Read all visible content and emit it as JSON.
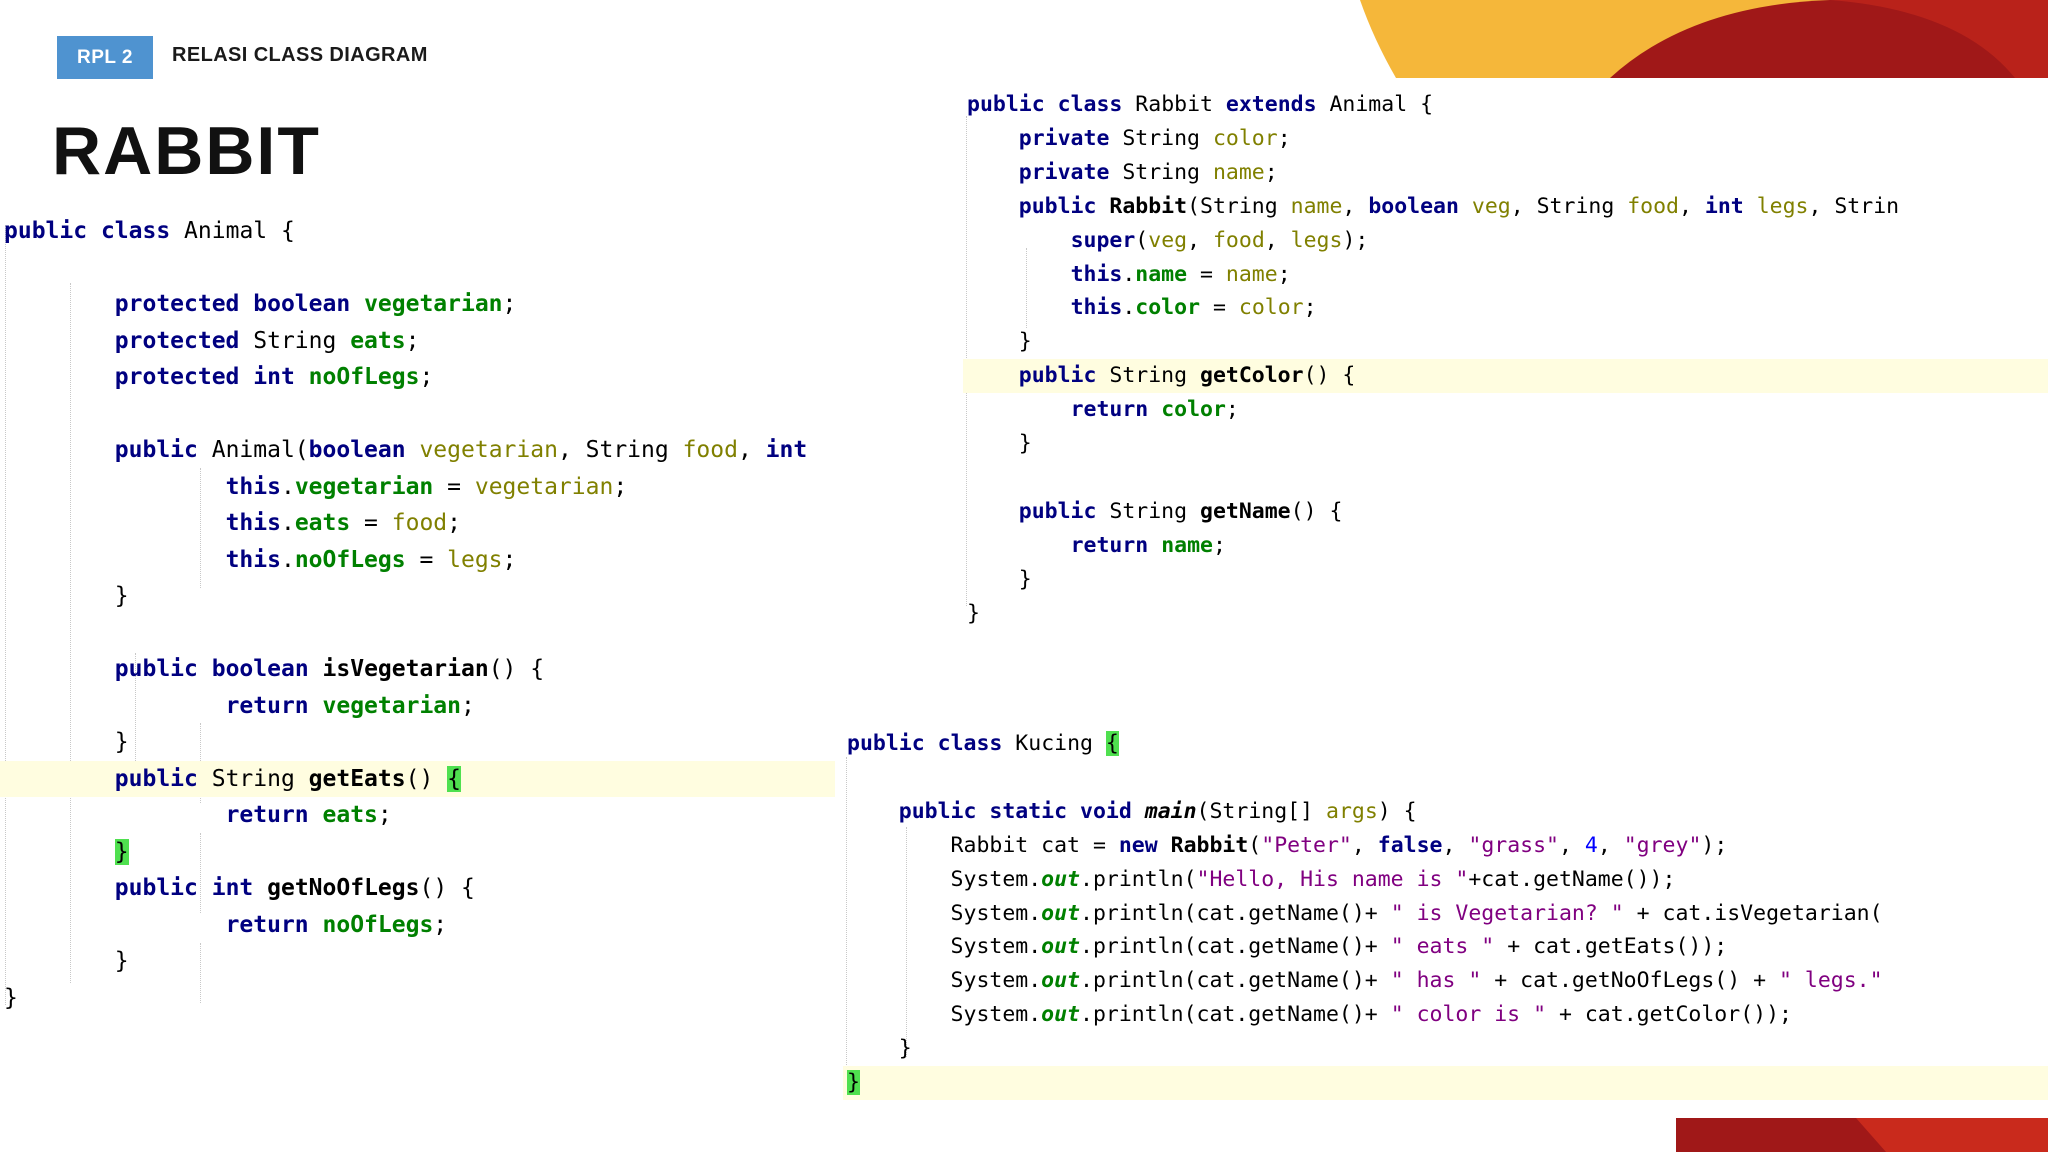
{
  "header": {
    "badge": "RPL 2",
    "subtitle": "RELASI CLASS DIAGRAM"
  },
  "slide": {
    "title": "RABBIT"
  },
  "colors": {
    "keyword": "#000080",
    "field": "#008000",
    "param": "#808000",
    "string": "#800080",
    "number": "#0000ff",
    "bracket_match": "#4fe04f",
    "line_highlight": "#fffde0",
    "badge": "#4f93d0",
    "accent_red": "#a01818",
    "accent_yellow": "#f5b73a"
  },
  "code": {
    "animal": [
      [
        {
          "t": "public",
          "c": "kw"
        },
        {
          "t": " "
        },
        {
          "t": "class",
          "c": "kw"
        },
        {
          "t": " Animal {"
        }
      ],
      [],
      [
        {
          "t": "        "
        },
        {
          "t": "protected",
          "c": "kw"
        },
        {
          "t": " "
        },
        {
          "t": "boolean",
          "c": "kw"
        },
        {
          "t": " "
        },
        {
          "t": "vegetarian",
          "c": "fld"
        },
        {
          "t": ";"
        }
      ],
      [
        {
          "t": "        "
        },
        {
          "t": "protected",
          "c": "kw"
        },
        {
          "t": " String "
        },
        {
          "t": "eats",
          "c": "fld"
        },
        {
          "t": ";"
        }
      ],
      [
        {
          "t": "        "
        },
        {
          "t": "protected",
          "c": "kw"
        },
        {
          "t": " "
        },
        {
          "t": "int",
          "c": "kw"
        },
        {
          "t": " "
        },
        {
          "t": "noOfLegs",
          "c": "fld"
        },
        {
          "t": ";"
        }
      ],
      [],
      [
        {
          "t": "        "
        },
        {
          "t": "public",
          "c": "kw"
        },
        {
          "t": " Animal("
        },
        {
          "t": "boolean",
          "c": "kw"
        },
        {
          "t": " "
        },
        {
          "t": "vegetarian",
          "c": "prm"
        },
        {
          "t": ", String "
        },
        {
          "t": "food",
          "c": "prm"
        },
        {
          "t": ", "
        },
        {
          "t": "int",
          "c": "kw"
        }
      ],
      [
        {
          "t": "                "
        },
        {
          "t": "this",
          "c": "kw"
        },
        {
          "t": "."
        },
        {
          "t": "vegetarian",
          "c": "fld"
        },
        {
          "t": " = "
        },
        {
          "t": "vegetarian",
          "c": "prm"
        },
        {
          "t": ";"
        }
      ],
      [
        {
          "t": "                "
        },
        {
          "t": "this",
          "c": "kw"
        },
        {
          "t": "."
        },
        {
          "t": "eats",
          "c": "fld"
        },
        {
          "t": " = "
        },
        {
          "t": "food",
          "c": "prm"
        },
        {
          "t": ";"
        }
      ],
      [
        {
          "t": "                "
        },
        {
          "t": "this",
          "c": "kw"
        },
        {
          "t": "."
        },
        {
          "t": "noOfLegs",
          "c": "fld"
        },
        {
          "t": " = "
        },
        {
          "t": "legs",
          "c": "prm"
        },
        {
          "t": ";"
        }
      ],
      [
        {
          "t": "        }"
        }
      ],
      [],
      [
        {
          "t": "        "
        },
        {
          "t": "public",
          "c": "kw"
        },
        {
          "t": " "
        },
        {
          "t": "boolean",
          "c": "kw"
        },
        {
          "t": " "
        },
        {
          "t": "isVegetarian",
          "c": "mt"
        },
        {
          "t": "() {"
        }
      ],
      [
        {
          "t": "                "
        },
        {
          "t": "return",
          "c": "kw"
        },
        {
          "t": " "
        },
        {
          "t": "vegetarian",
          "c": "fld"
        },
        {
          "t": ";"
        }
      ],
      [
        {
          "t": "        }"
        }
      ],
      [
        {
          "t": "        "
        },
        {
          "t": "public",
          "c": "kw"
        },
        {
          "t": " String "
        },
        {
          "t": "getEats",
          "c": "mt"
        },
        {
          "t": "() "
        },
        {
          "t": "{",
          "c": "brm"
        }
      ],
      [
        {
          "t": "                "
        },
        {
          "t": "return",
          "c": "kw"
        },
        {
          "t": " "
        },
        {
          "t": "eats",
          "c": "fld"
        },
        {
          "t": ";"
        }
      ],
      [
        {
          "t": "        "
        },
        {
          "t": "}",
          "c": "brm"
        }
      ],
      [
        {
          "t": "        "
        },
        {
          "t": "public",
          "c": "kw"
        },
        {
          "t": " "
        },
        {
          "t": "int",
          "c": "kw"
        },
        {
          "t": " "
        },
        {
          "t": "getNoOfLegs",
          "c": "mt"
        },
        {
          "t": "() {"
        }
      ],
      [
        {
          "t": "                "
        },
        {
          "t": "return",
          "c": "kw"
        },
        {
          "t": " "
        },
        {
          "t": "noOfLegs",
          "c": "fld"
        },
        {
          "t": ";"
        }
      ],
      [
        {
          "t": "        }"
        }
      ],
      [
        {
          "t": "}"
        }
      ]
    ],
    "rabbit": [
      [
        {
          "t": "public",
          "c": "kw"
        },
        {
          "t": " "
        },
        {
          "t": "class",
          "c": "kw"
        },
        {
          "t": " Rabbit "
        },
        {
          "t": "extends",
          "c": "kw"
        },
        {
          "t": " Animal {"
        }
      ],
      [
        {
          "t": "    "
        },
        {
          "t": "private",
          "c": "kw"
        },
        {
          "t": " String "
        },
        {
          "t": "color",
          "c": "prm"
        },
        {
          "t": ";"
        }
      ],
      [
        {
          "t": "    "
        },
        {
          "t": "private",
          "c": "kw"
        },
        {
          "t": " String "
        },
        {
          "t": "name",
          "c": "prm"
        },
        {
          "t": ";"
        }
      ],
      [
        {
          "t": "    "
        },
        {
          "t": "public",
          "c": "kw"
        },
        {
          "t": " "
        },
        {
          "t": "Rabbit",
          "c": "mt"
        },
        {
          "t": "(String "
        },
        {
          "t": "name",
          "c": "prm"
        },
        {
          "t": ", "
        },
        {
          "t": "boolean",
          "c": "kw"
        },
        {
          "t": " "
        },
        {
          "t": "veg",
          "c": "prm"
        },
        {
          "t": ", String "
        },
        {
          "t": "food",
          "c": "prm"
        },
        {
          "t": ", "
        },
        {
          "t": "int",
          "c": "kw"
        },
        {
          "t": " "
        },
        {
          "t": "legs",
          "c": "prm"
        },
        {
          "t": ", Strin"
        }
      ],
      [
        {
          "t": "        "
        },
        {
          "t": "super",
          "c": "kw"
        },
        {
          "t": "("
        },
        {
          "t": "veg",
          "c": "prm"
        },
        {
          "t": ", "
        },
        {
          "t": "food",
          "c": "prm"
        },
        {
          "t": ", "
        },
        {
          "t": "legs",
          "c": "prm"
        },
        {
          "t": ");"
        }
      ],
      [
        {
          "t": "        "
        },
        {
          "t": "this",
          "c": "kw"
        },
        {
          "t": "."
        },
        {
          "t": "name",
          "c": "fld"
        },
        {
          "t": " = "
        },
        {
          "t": "name",
          "c": "prm"
        },
        {
          "t": ";"
        }
      ],
      [
        {
          "t": "        "
        },
        {
          "t": "this",
          "c": "kw"
        },
        {
          "t": "."
        },
        {
          "t": "color",
          "c": "fld"
        },
        {
          "t": " = "
        },
        {
          "t": "color",
          "c": "prm"
        },
        {
          "t": ";"
        }
      ],
      [
        {
          "t": "    }"
        }
      ],
      [
        {
          "t": "    "
        },
        {
          "t": "public",
          "c": "kw"
        },
        {
          "t": " String "
        },
        {
          "t": "getColor",
          "c": "mt"
        },
        {
          "t": "() {"
        }
      ],
      [
        {
          "t": "        "
        },
        {
          "t": "return",
          "c": "kw"
        },
        {
          "t": " "
        },
        {
          "t": "color",
          "c": "fld"
        },
        {
          "t": ";"
        }
      ],
      [
        {
          "t": "    }"
        }
      ],
      [],
      [
        {
          "t": "    "
        },
        {
          "t": "public",
          "c": "kw"
        },
        {
          "t": " String "
        },
        {
          "t": "getName",
          "c": "mt"
        },
        {
          "t": "() {"
        }
      ],
      [
        {
          "t": "        "
        },
        {
          "t": "return",
          "c": "kw"
        },
        {
          "t": " "
        },
        {
          "t": "name",
          "c": "fld"
        },
        {
          "t": ";"
        }
      ],
      [
        {
          "t": "    }"
        }
      ],
      [
        {
          "t": "}"
        }
      ]
    ],
    "kucing": [
      [
        {
          "t": "public",
          "c": "kw"
        },
        {
          "t": " "
        },
        {
          "t": "class",
          "c": "kw"
        },
        {
          "t": " Kucing "
        },
        {
          "t": "{",
          "c": "brm"
        }
      ],
      [],
      [
        {
          "t": "    "
        },
        {
          "t": "public",
          "c": "kw"
        },
        {
          "t": " "
        },
        {
          "t": "static",
          "c": "kw"
        },
        {
          "t": " "
        },
        {
          "t": "void",
          "c": "kw"
        },
        {
          "t": " "
        },
        {
          "t": "main",
          "c": "mi"
        },
        {
          "t": "(String[] "
        },
        {
          "t": "args",
          "c": "prm"
        },
        {
          "t": ") {"
        }
      ],
      [
        {
          "t": "        Rabbit cat = "
        },
        {
          "t": "new",
          "c": "kw"
        },
        {
          "t": " "
        },
        {
          "t": "Rabbit",
          "c": "mt"
        },
        {
          "t": "("
        },
        {
          "t": "\"Peter\"",
          "c": "str"
        },
        {
          "t": ", "
        },
        {
          "t": "false",
          "c": "kw"
        },
        {
          "t": ", "
        },
        {
          "t": "\"grass\"",
          "c": "str"
        },
        {
          "t": ", "
        },
        {
          "t": "4",
          "c": "num"
        },
        {
          "t": ", "
        },
        {
          "t": "\"grey\"",
          "c": "str"
        },
        {
          "t": ");"
        }
      ],
      [
        {
          "t": "        System."
        },
        {
          "t": "out",
          "c": "st"
        },
        {
          "t": ".println("
        },
        {
          "t": "\"Hello, His name is \"",
          "c": "str"
        },
        {
          "t": "+cat.getName());"
        }
      ],
      [
        {
          "t": "        System."
        },
        {
          "t": "out",
          "c": "st"
        },
        {
          "t": ".println(cat.getName()+ "
        },
        {
          "t": "\" is Vegetarian? \"",
          "c": "str"
        },
        {
          "t": " + cat.isVegetarian("
        }
      ],
      [
        {
          "t": "        System."
        },
        {
          "t": "out",
          "c": "st"
        },
        {
          "t": ".println(cat.getName()+ "
        },
        {
          "t": "\" eats \"",
          "c": "str"
        },
        {
          "t": " + cat.getEats());"
        }
      ],
      [
        {
          "t": "        System."
        },
        {
          "t": "out",
          "c": "st"
        },
        {
          "t": ".println(cat.getName()+ "
        },
        {
          "t": "\" has \"",
          "c": "str"
        },
        {
          "t": " + cat.getNoOfLegs() + "
        },
        {
          "t": "\" legs.\"",
          "c": "str"
        }
      ],
      [
        {
          "t": "        System."
        },
        {
          "t": "out",
          "c": "st"
        },
        {
          "t": ".println(cat.getName()+ "
        },
        {
          "t": "\" color is \"",
          "c": "str"
        },
        {
          "t": " + cat.getColor());"
        }
      ],
      [
        {
          "t": "    }"
        }
      ],
      [
        {
          "t": "}",
          "c": "brm"
        }
      ]
    ]
  }
}
